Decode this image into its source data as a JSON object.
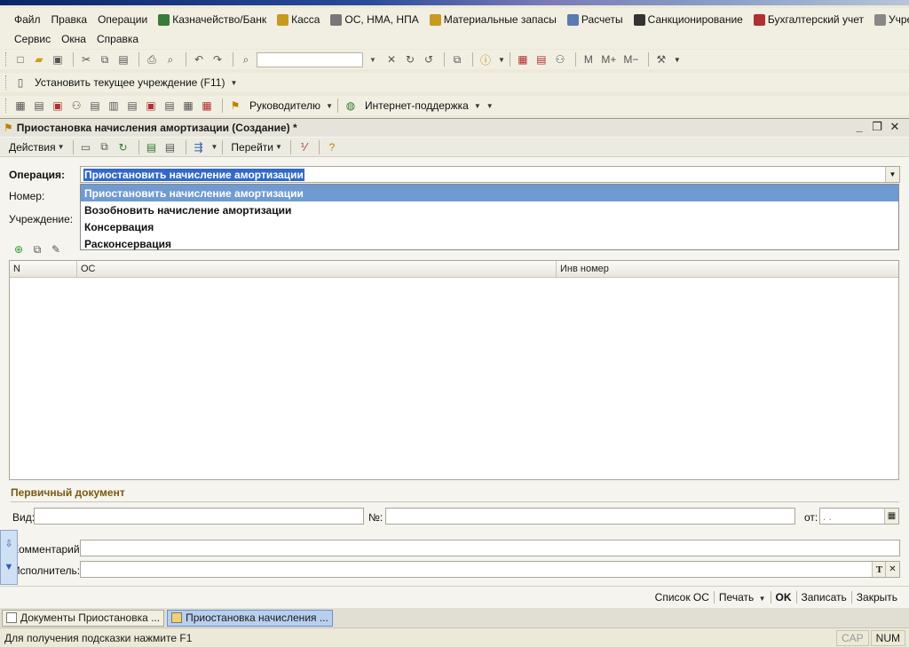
{
  "menu": {
    "row1": [
      {
        "label": "Файл",
        "icon": "none"
      },
      {
        "label": "Правка",
        "icon": "none"
      },
      {
        "label": "Операции",
        "icon": "none"
      },
      {
        "label": "Казначейство/Банк",
        "icon": "bank-icon"
      },
      {
        "label": "Касса",
        "icon": "coins-icon"
      },
      {
        "label": "ОС, НМА, НПА",
        "icon": "truck-icon"
      },
      {
        "label": "Материальные запасы",
        "icon": "box-icon"
      },
      {
        "label": "Расчеты",
        "icon": "ledger-icon"
      },
      {
        "label": "Санкционирование",
        "icon": "sigma-icon"
      },
      {
        "label": "Бухгалтерский учет",
        "icon": "dt-kt-icon"
      },
      {
        "label": "Учреждение",
        "icon": "doc-icon"
      }
    ],
    "row2": [
      {
        "label": "Сервис"
      },
      {
        "label": "Окна"
      },
      {
        "label": "Справка"
      }
    ]
  },
  "toolbar2": {
    "set_institution": "Установить текущее учреждение (F11)"
  },
  "toolbar3": {
    "manager": "Руководителю",
    "support": "Интернет-поддержка"
  },
  "form": {
    "title": "Приостановка начисления амортизации (Создание) *",
    "toolbar": {
      "actions": "Действия",
      "goto": "Перейти"
    },
    "labels": {
      "operation": "Операция:",
      "number": "Номер:",
      "institution": "Учреждение:"
    },
    "operation_value": "Приостановить начисление амортизации",
    "operation_options": [
      "Приостановить начисление амортизации",
      "Возобновить начисление амортизации",
      "Консервация",
      "Расконсервация"
    ],
    "grid_columns": [
      "N",
      "ОС",
      "Инв номер"
    ],
    "primary_doc": {
      "title": "Первичный документ",
      "kind": "Вид:",
      "number": "№:",
      "date_from": "от:",
      "date_placeholder": " .  .  "
    },
    "comment_label": "Комментарий:",
    "executor_label": "Исполнитель:",
    "bottom_buttons": {
      "os_list": "Список ОС",
      "print": "Печать",
      "ok": "OK",
      "save": "Записать",
      "close": "Закрыть"
    }
  },
  "taskbar": [
    {
      "label": "Документы Приостановка ..."
    },
    {
      "label": "Приостановка начисления ..."
    }
  ],
  "status": {
    "hint": "Для получения подсказки нажмите F1",
    "cap": "CAP",
    "num": "NUM"
  }
}
